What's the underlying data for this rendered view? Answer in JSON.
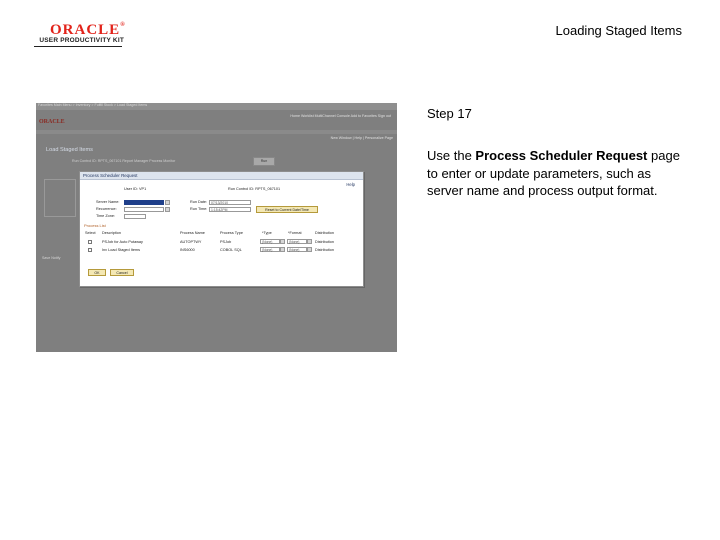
{
  "header": {
    "logo_brand": "ORACLE",
    "logo_registered": "®",
    "logo_product": "USER PRODUCTIVITY KIT",
    "title": "Loading Staged Items"
  },
  "step": {
    "label": "Step 17"
  },
  "instruction": {
    "prefix": "Use the ",
    "emphasis": "Process Scheduler Request",
    "suffix": " page to enter or update parameters, such as server name and process output format."
  },
  "colors": {
    "oracle_red": "#e2231a",
    "screenshot_background": "#7f7f7f",
    "modal_titlebar": "#dde4ee",
    "selected_field": "#1f3f8a",
    "section_label": "#b1622a",
    "button_fill": "#f4e8b4"
  },
  "screenshot": {
    "top_bar_text": "Favorites   Main Menu   >   Inventory   >   Fulfill Stock   >   Load Staged Items",
    "top_links": "Home    Worklist    MultiChannel Console    Add to Favorites    Sign out",
    "ps_logo": "ORACLE",
    "new_window_links": "New Window | Help | Personalize Page",
    "page_heading": "Load Staged Items",
    "run_row": "Run Control ID: RPTS_067101      Report Manager      Process Monitor",
    "run_button": "Run",
    "bottom_text": "Save   Notify",
    "modal": {
      "title": "Process Scheduler Request",
      "help": "Help",
      "user_id_label": "User ID:",
      "user_id_value": "VP1",
      "run_control_label": "Run Control ID:",
      "run_control_value": "RPTS_067101",
      "server_name_label": "Server Name:",
      "run_date_label": "Run Date:",
      "run_date_value": "07/13/2010",
      "recurrence_label": "Recurrence:",
      "run_time_label": "Run Time:",
      "run_time_value": "1:15:42PM",
      "reset_button": "Reset to Current Date/Time",
      "time_zone_label": "Time Zone:",
      "process_list_heading": "Process List",
      "columns": [
        "Select",
        "Description",
        "Process Name",
        "Process Type",
        "*Type",
        "*Format",
        "Distribution"
      ],
      "rows": [
        {
          "description": "PSJob for Auto Putaway",
          "process_name": "AUTOPTWY",
          "process_type": "PSJob",
          "type": "(None)",
          "format": "(None)",
          "distribution": "Distribution"
        },
        {
          "description": "Inv Load Staged Items",
          "process_name": "INS6000",
          "process_type": "COBOL SQL",
          "type": "(None)",
          "format": "(None)",
          "distribution": "Distribution"
        }
      ],
      "ok_button": "OK",
      "cancel_button": "Cancel"
    }
  }
}
